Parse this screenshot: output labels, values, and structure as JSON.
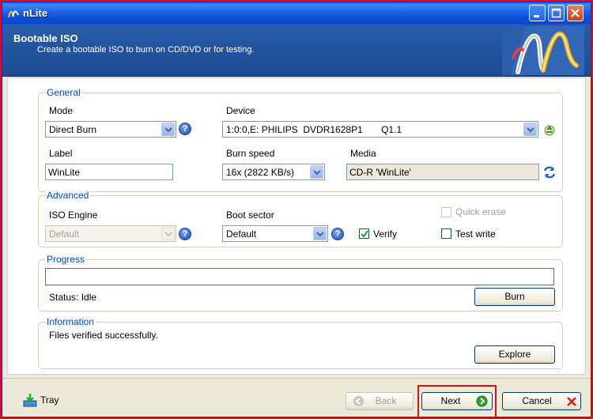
{
  "window": {
    "title": "nLite"
  },
  "header": {
    "title": "Bootable ISO",
    "subtitle": "Create a bootable ISO to burn on CD/DVD or for testing."
  },
  "general": {
    "group_label": "General",
    "mode_label": "Mode",
    "mode_value": "Direct Burn",
    "device_label": "Device",
    "device_value": "1:0:0,E: PHILIPS  DVDR1628P1       Q1.1",
    "label_label": "Label",
    "label_value": "WinLite",
    "burn_speed_label": "Burn speed",
    "burn_speed_value": "16x (2822 KB/s)",
    "media_label": "Media",
    "media_value": "CD-R 'WinLite'"
  },
  "advanced": {
    "group_label": "Advanced",
    "iso_engine_label": "ISO Engine",
    "iso_engine_value": "Default",
    "boot_sector_label": "Boot sector",
    "boot_sector_value": "Default",
    "verify_label": "Verify",
    "verify_checked": true,
    "quick_erase_label": "Quick erase",
    "test_write_label": "Test write"
  },
  "progress": {
    "group_label": "Progress",
    "status_text": "Status: Idle",
    "burn_label": "Burn"
  },
  "information": {
    "group_label": "Information",
    "message": "Files verified successfully.",
    "explore_label": "Explore"
  },
  "footer": {
    "tray_label": "Tray",
    "back_label": "Back",
    "next_label": "Next",
    "cancel_label": "Cancel"
  },
  "icons": {
    "help": "help-icon",
    "eject": "eject-icon",
    "refresh": "refresh-icon",
    "back": "back-arrow-icon",
    "next": "next-arrow-icon",
    "cancel": "cancel-x-icon",
    "tray": "tray-icon"
  }
}
